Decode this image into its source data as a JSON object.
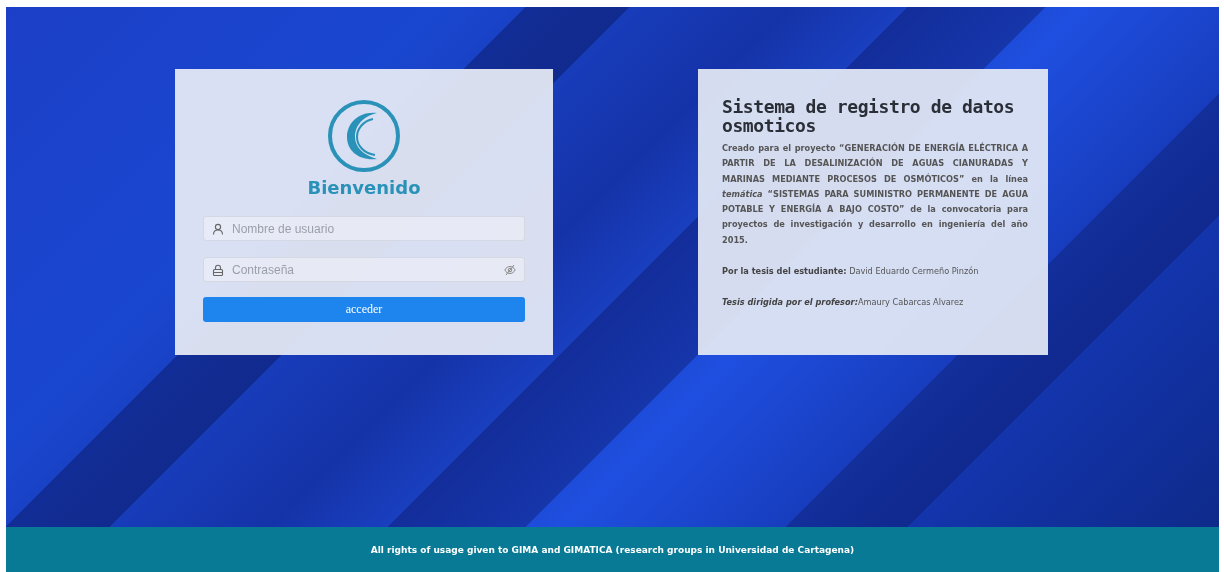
{
  "login": {
    "title": "Bienvenido",
    "fields": [
      {
        "kind": "text",
        "placeholder": "Nombre de usuario"
      },
      {
        "kind": "password",
        "placeholder": "Contraseña"
      }
    ],
    "button": "acceder"
  },
  "info": {
    "title": "Sistema de registro de datos osmoticos",
    "description": "Creado para el proyecto “GENERACIÓN DE ENERGÍA ELÉCTRICA A PARTIR DE LA DESALINIZACIÓN DE AGUAS CIANURADAS Y MARINAS MEDIANTE PROCESOS DE OSMÓTICOS” en la línea *temática* “SISTEMAS PARA SUMINISTRO PERMANENTE DE AGUA POTABLE Y ENERGÍA A BAJO COSTO” de la convocatoria para proyectos de investigación y desarrollo en ingeniería del año 2015.",
    "credits": [
      "**Por la tesis del estudiante:** David Eduardo Cermeño Pinzón",
      "**Tesis dirigida por el profesor:**Amaury Cabarcas Alvarez"
    ]
  },
  "footer": "All rights of usage given to GIMA and GIMATICA (research groups in Universidad de Cartagena)"
}
